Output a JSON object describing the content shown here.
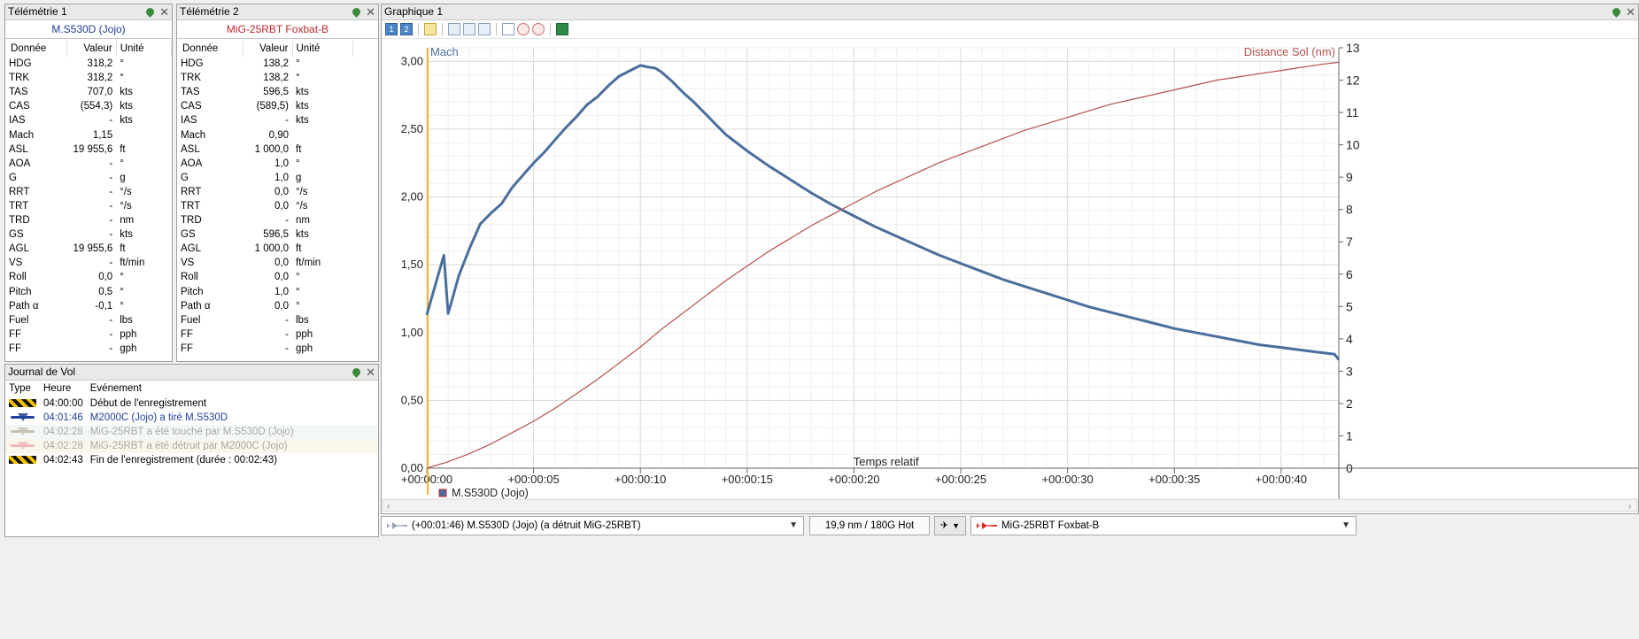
{
  "tele1": {
    "title": "Télémétrie 1",
    "aircraft": "M.S530D (Jojo)",
    "aircraft_color": "#1f3f9a",
    "headers": [
      "Donnée",
      "Valeur",
      "Unité"
    ],
    "rows": [
      [
        "HDG",
        "318,2",
        "°"
      ],
      [
        "TRK",
        "318,2",
        "°"
      ],
      [
        "TAS",
        "707,0",
        "kts"
      ],
      [
        "CAS",
        "(554,3)",
        "kts"
      ],
      [
        "IAS",
        "-",
        "kts"
      ],
      [
        "Mach",
        "1,15",
        ""
      ],
      [
        "ASL",
        "19 955,6",
        "ft"
      ],
      [
        "AOA",
        "-",
        "°"
      ],
      [
        "G",
        "-",
        "g"
      ],
      [
        "RRT",
        "-",
        "°/s"
      ],
      [
        "TRT",
        "-",
        "°/s"
      ],
      [
        "TRD",
        "-",
        "nm"
      ],
      [
        "GS",
        "-",
        "kts"
      ],
      [
        "AGL",
        "19 955,6",
        "ft"
      ],
      [
        "VS",
        "-",
        "ft/min"
      ],
      [
        "Roll",
        "0,0",
        "°"
      ],
      [
        "Pitch",
        "0,5",
        "°"
      ],
      [
        "Path α",
        "-0,1",
        "°"
      ],
      [
        "Fuel",
        "-",
        "lbs"
      ],
      [
        "FF",
        "-",
        "pph"
      ],
      [
        "FF",
        "-",
        "gph"
      ]
    ]
  },
  "tele2": {
    "title": "Télémétrie 2",
    "aircraft": "MiG-25RBT Foxbat-B",
    "aircraft_color": "#c0282d",
    "headers": [
      "Donnée",
      "Valeur",
      "Unité"
    ],
    "rows": [
      [
        "HDG",
        "138,2",
        "°"
      ],
      [
        "TRK",
        "138,2",
        "°"
      ],
      [
        "TAS",
        "596,5",
        "kts"
      ],
      [
        "CAS",
        "(589,5)",
        "kts"
      ],
      [
        "IAS",
        "-",
        "kts"
      ],
      [
        "Mach",
        "0,90",
        ""
      ],
      [
        "ASL",
        "1 000,0",
        "ft"
      ],
      [
        "AOA",
        "1,0",
        "°"
      ],
      [
        "G",
        "1,0",
        "g"
      ],
      [
        "RRT",
        "0,0",
        "°/s"
      ],
      [
        "TRT",
        "0,0",
        "°/s"
      ],
      [
        "TRD",
        "-",
        "nm"
      ],
      [
        "GS",
        "596,5",
        "kts"
      ],
      [
        "AGL",
        "1 000,0",
        "ft"
      ],
      [
        "VS",
        "0,0",
        "ft/min"
      ],
      [
        "Roll",
        "0,0",
        "°"
      ],
      [
        "Pitch",
        "1,0",
        "°"
      ],
      [
        "Path α",
        "0,0",
        "°"
      ],
      [
        "Fuel",
        "-",
        "lbs"
      ],
      [
        "FF",
        "-",
        "pph"
      ],
      [
        "FF",
        "-",
        "gph"
      ]
    ]
  },
  "journal": {
    "title": "Journal de Vol",
    "headers": [
      "Type",
      "Heure",
      "Evénement"
    ],
    "rows": [
      {
        "icon": "hazard-stripe-icon",
        "time": "04:00:00",
        "event": "Début de l'enregistrement",
        "color": "#000000",
        "faded": false
      },
      {
        "icon": "blue-plane-icon",
        "time": "04:01:46",
        "event": "M2000C (Jojo) a tiré M.S530D",
        "color": "#1f3f9a",
        "faded": false
      },
      {
        "icon": "grey-plane-icon",
        "time": "04:02:28",
        "event": "MiG-25RBT a été touché par M.S530D (Jojo)",
        "color": "#a8a8a8",
        "faded": true
      },
      {
        "icon": "pink-plane-icon",
        "time": "04:02:28",
        "event": "MiG-25RBT a été détruit par M2000C (Jojo)",
        "color": "#a8a8a8",
        "faded": true
      },
      {
        "icon": "hazard-stripe-icon",
        "time": "04:02:43",
        "event": "Fin de l'enregistrement (durée : 00:02:43)",
        "color": "#000000",
        "faded": false
      }
    ]
  },
  "graph": {
    "title": "Graphique 1",
    "toolbar_labels": [
      "1",
      "2"
    ],
    "legend": "M.S530D (Jojo)"
  },
  "chart_data": {
    "type": "line",
    "xlabel": "Temps relatif",
    "x_ticks": [
      "+00:00:00",
      "+00:00:05",
      "+00:00:10",
      "+00:00:15",
      "+00:00:20",
      "+00:00:25",
      "+00:00:30",
      "+00:00:35",
      "+00:00:40"
    ],
    "xlim": [
      0,
      42.7
    ],
    "y_left": {
      "label": "Mach",
      "ticks": [
        "0,00",
        "0,50",
        "1,00",
        "1,50",
        "2,00",
        "2,50",
        "3,00"
      ],
      "lim": [
        0,
        3.1
      ]
    },
    "y_right": {
      "label": "Distance Sol (nm)",
      "ticks": [
        "0",
        "1",
        "2",
        "3",
        "4",
        "5",
        "6",
        "7",
        "8",
        "9",
        "10",
        "11",
        "12",
        "13"
      ],
      "lim": [
        0,
        13
      ]
    },
    "series": [
      {
        "name": "Mach",
        "axis": "left",
        "color": "#4a6e9c",
        "x": [
          0,
          0.4,
          0.8,
          1.0,
          1.2,
          1.5,
          2.0,
          2.5,
          3.0,
          3.5,
          4.0,
          4.5,
          5.0,
          5.5,
          6.0,
          6.5,
          7.0,
          7.5,
          8.0,
          8.5,
          9.0,
          9.5,
          10.0,
          10.3,
          10.7,
          11.0,
          11.5,
          12.0,
          12.5,
          13.0,
          13.5,
          14.0,
          15.0,
          16.0,
          17.0,
          18.0,
          19.0,
          20.0,
          21.0,
          22.0,
          23.0,
          24.0,
          25.0,
          26.0,
          27.0,
          28.0,
          29.0,
          30.0,
          31.0,
          32.0,
          33.0,
          34.0,
          35.0,
          36.0,
          37.0,
          38.0,
          39.0,
          40.0,
          41.0,
          42.0,
          42.5,
          42.7
        ],
        "y": [
          1.13,
          1.35,
          1.57,
          1.14,
          1.25,
          1.42,
          1.62,
          1.8,
          1.88,
          1.95,
          2.07,
          2.16,
          2.25,
          2.33,
          2.42,
          2.51,
          2.59,
          2.68,
          2.74,
          2.82,
          2.89,
          2.93,
          2.97,
          2.96,
          2.95,
          2.92,
          2.85,
          2.77,
          2.7,
          2.62,
          2.54,
          2.46,
          2.34,
          2.23,
          2.13,
          2.03,
          1.94,
          1.86,
          1.78,
          1.71,
          1.64,
          1.57,
          1.51,
          1.45,
          1.39,
          1.34,
          1.29,
          1.24,
          1.19,
          1.15,
          1.11,
          1.07,
          1.03,
          1.0,
          0.97,
          0.94,
          0.91,
          0.89,
          0.87,
          0.85,
          0.84,
          0.8
        ]
      },
      {
        "name": "Distance Sol (nm)",
        "axis": "right",
        "color": "#b5504a",
        "x": [
          0,
          1,
          2,
          3,
          4,
          5,
          6,
          7,
          8,
          9,
          10,
          11,
          12,
          13,
          14,
          15,
          16,
          17,
          18,
          19,
          20,
          21,
          22,
          23,
          24,
          25,
          26,
          27,
          28,
          29,
          30,
          31,
          32,
          33,
          34,
          35,
          36,
          37,
          38,
          39,
          40,
          41,
          42,
          42.7
        ],
        "y": [
          0,
          0.2,
          0.45,
          0.75,
          1.1,
          1.45,
          1.85,
          2.3,
          2.75,
          3.25,
          3.75,
          4.3,
          4.8,
          5.3,
          5.8,
          6.25,
          6.7,
          7.1,
          7.5,
          7.85,
          8.2,
          8.55,
          8.85,
          9.15,
          9.45,
          9.7,
          9.95,
          10.2,
          10.45,
          10.65,
          10.85,
          11.05,
          11.25,
          11.4,
          11.55,
          11.7,
          11.85,
          12.0,
          12.1,
          12.2,
          12.3,
          12.4,
          12.5,
          12.55
        ]
      }
    ]
  },
  "status": {
    "event_selector": "(+00:01:46) M.S530D (Jojo) (a détruit MiG-25RBT)",
    "distance": "19,9 nm / 180G Hot",
    "target_selector": "MiG-25RBT Foxbat-B"
  }
}
